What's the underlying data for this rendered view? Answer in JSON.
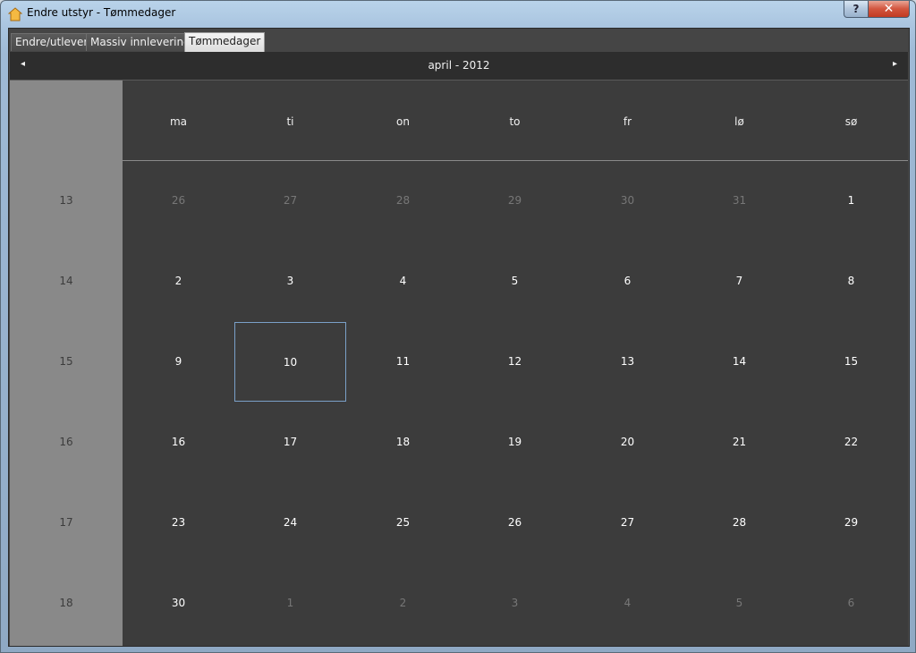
{
  "window": {
    "title": "Endre utstyr - Tømmedager",
    "help_label": "?",
    "close_label": "✕"
  },
  "tabs": [
    {
      "label": "Endre/utlever"
    },
    {
      "label": "Massiv innlevering"
    },
    {
      "label": "Tømmedager"
    }
  ],
  "calendar": {
    "month_label": "april - 2012",
    "prev_label": "◂",
    "next_label": "▸",
    "day_names": [
      "ma",
      "ti",
      "on",
      "to",
      "fr",
      "lø",
      "sø"
    ],
    "week_numbers": [
      "13",
      "14",
      "15",
      "16",
      "17",
      "18"
    ],
    "weeks": [
      [
        "26",
        "27",
        "28",
        "29",
        "30",
        "31",
        "1"
      ],
      [
        "2",
        "3",
        "4",
        "5",
        "6",
        "7",
        "8"
      ],
      [
        "9",
        "10",
        "11",
        "12",
        "13",
        "14",
        "15"
      ],
      [
        "16",
        "17",
        "18",
        "19",
        "20",
        "21",
        "22"
      ],
      [
        "23",
        "24",
        "25",
        "26",
        "27",
        "28",
        "29"
      ],
      [
        "30",
        "1",
        "2",
        "3",
        "4",
        "5",
        "6"
      ]
    ],
    "selected_day": "10",
    "colors": {
      "background": "#3c3c3c",
      "week_column": "#898989",
      "selection_border": "#7aa0c8",
      "other_month_text": "#777777"
    }
  }
}
